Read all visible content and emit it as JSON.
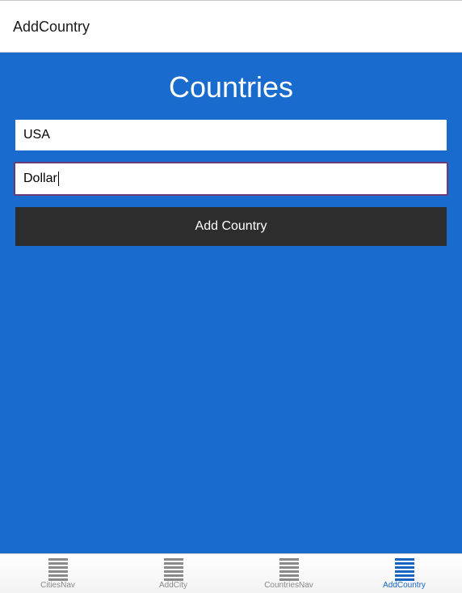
{
  "header": {
    "title": "AddCountry"
  },
  "main": {
    "title": "Countries",
    "country_field": {
      "value": "USA"
    },
    "currency_field": {
      "value": "Dollar"
    },
    "add_button_label": "Add Country"
  },
  "tabs": [
    {
      "label": "CitiesNav",
      "icon": "list-icon",
      "active": false
    },
    {
      "label": "AddCity",
      "icon": "list-icon",
      "active": false
    },
    {
      "label": "CountriesNav",
      "icon": "list-icon",
      "active": false
    },
    {
      "label": "AddCountry",
      "icon": "list-icon",
      "active": true
    }
  ],
  "colors": {
    "main_background": "#196ccd",
    "button_background": "#2d2d2d",
    "focus_border": "#6b3a78",
    "tab_active": "#1565c0",
    "tab_inactive": "#8a8a8a"
  }
}
